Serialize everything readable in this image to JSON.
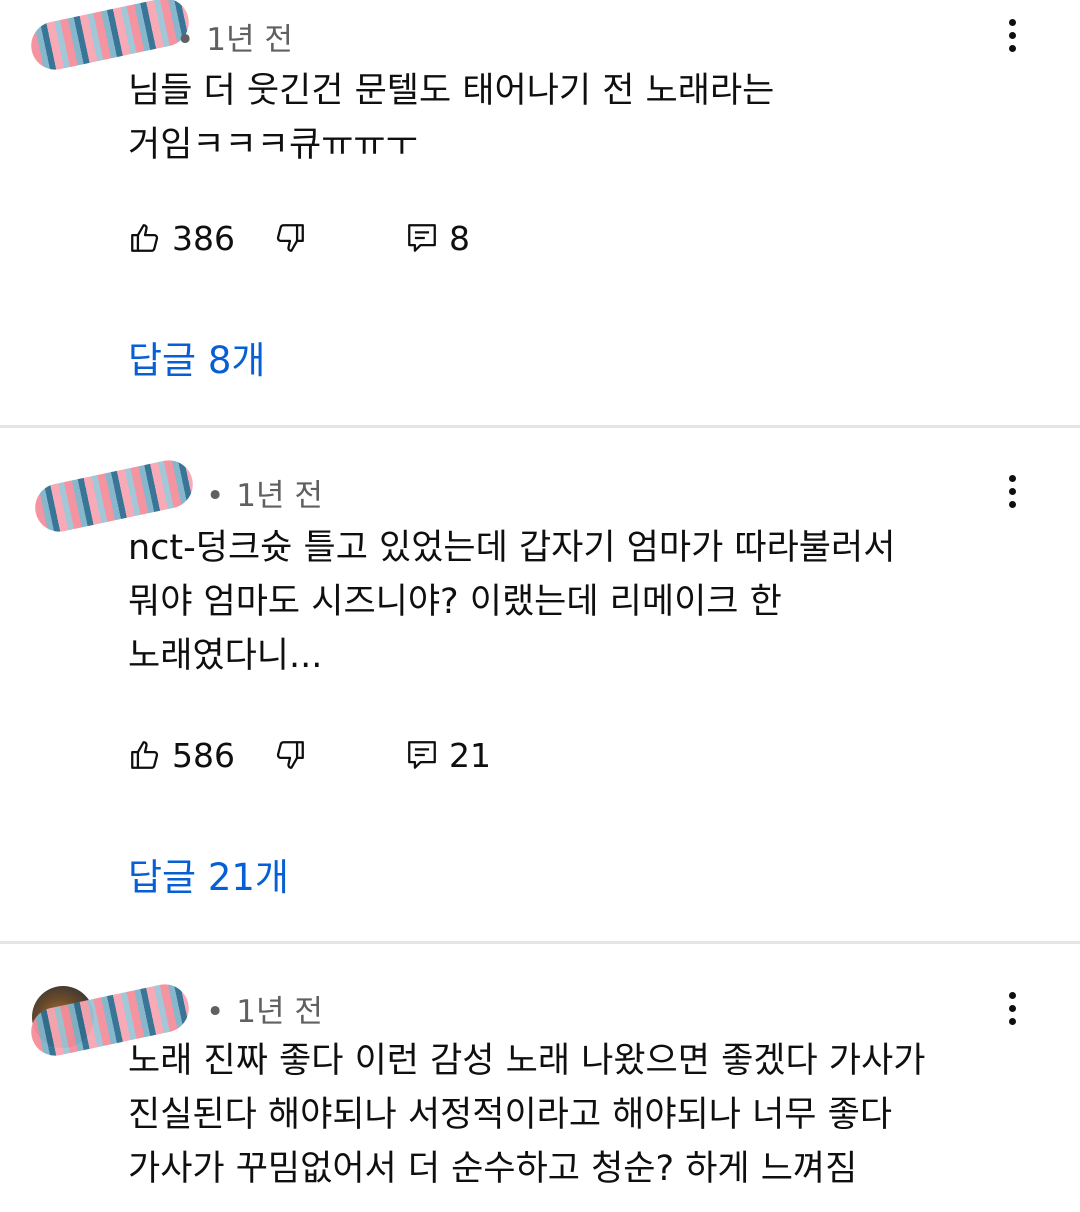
{
  "comments": [
    {
      "time": "1년 전",
      "text_lines": [
        "님들 더 웃긴건 문텔도 태어나기 전 노래라는",
        "거임ㅋㅋㅋ큐ㅠㅠㅜ"
      ],
      "likes": "386",
      "reply_count": "8",
      "replies_label": "답글 8개"
    },
    {
      "time": "1년 전",
      "text_lines": [
        "nct-덩크슛 틀고 있었는데 갑자기 엄마가 따라불러서",
        "뭐야 엄마도 시즈니야? 이랬는데 리메이크 한",
        "노래였다니..."
      ],
      "likes": "586",
      "reply_count": "21",
      "replies_label": "답글 21개"
    },
    {
      "time": "1년 전",
      "text_lines": [
        "노래 진짜 좋다 이런 감성 노래 나왔으면 좋겠다 가사가",
        "진실된다 해야되나 서정적이라고 해야되나 너무 좋다",
        "가사가 꾸밈없어서 더 순수하고 청순? 하게 느껴짐"
      ]
    }
  ],
  "icons": {
    "like": "thumbs-up-icon",
    "dislike": "thumbs-down-icon",
    "reply": "reply-icon",
    "menu": "more-vertical-icon"
  },
  "colors": {
    "link": "#065fd4",
    "meta": "#606060",
    "divider": "#e5e5e5"
  }
}
